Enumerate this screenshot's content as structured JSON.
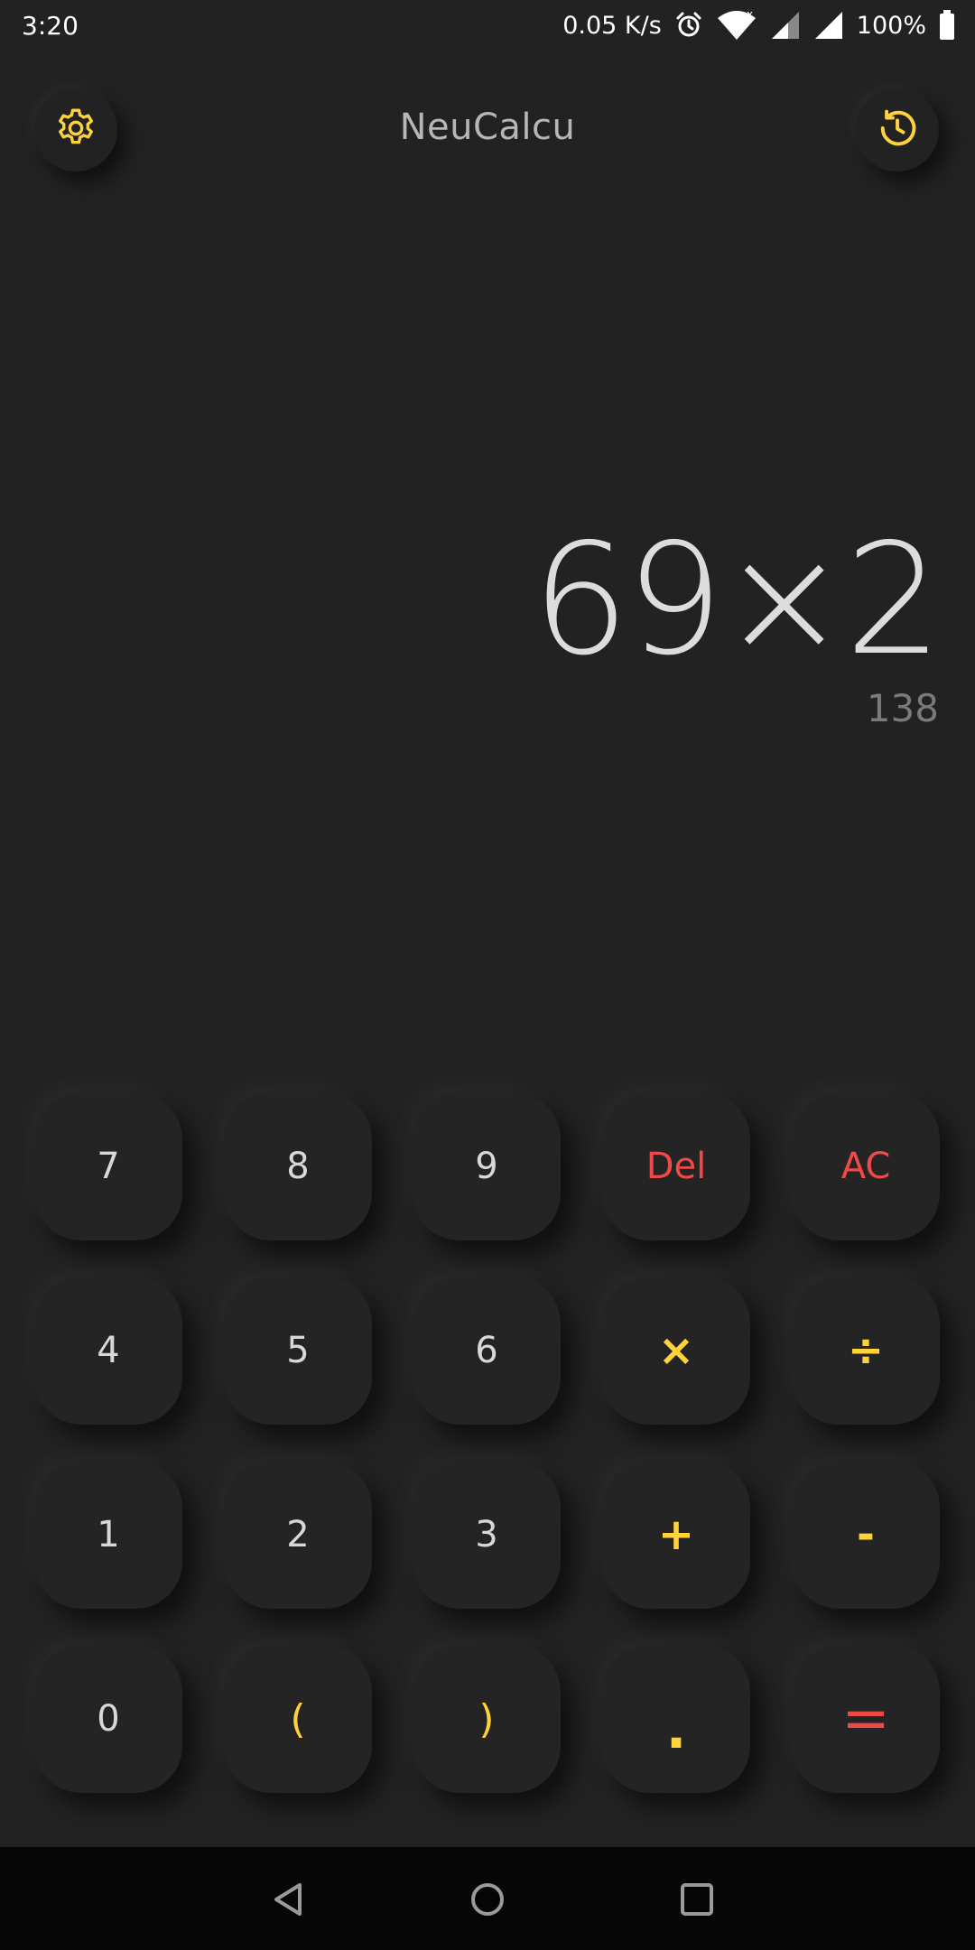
{
  "status_bar": {
    "time": "3:20",
    "network_speed": "0.05 K/s",
    "battery": "100%",
    "icons": [
      "alarm-icon",
      "wifi-icon",
      "signal-icon",
      "signal-icon",
      "battery-icon"
    ]
  },
  "header": {
    "title": "NeuCalcu",
    "settings_icon": "gear-icon",
    "history_icon": "history-icon"
  },
  "display": {
    "expression": "69×2",
    "result": "138"
  },
  "keypad": {
    "rows": [
      [
        {
          "label": "7",
          "type": "digit"
        },
        {
          "label": "8",
          "type": "digit"
        },
        {
          "label": "9",
          "type": "digit"
        },
        {
          "label": "Del",
          "type": "danger"
        },
        {
          "label": "AC",
          "type": "danger"
        }
      ],
      [
        {
          "label": "4",
          "type": "digit"
        },
        {
          "label": "5",
          "type": "digit"
        },
        {
          "label": "6",
          "type": "digit"
        },
        {
          "label": "×",
          "type": "op"
        },
        {
          "label": "÷",
          "type": "op"
        }
      ],
      [
        {
          "label": "1",
          "type": "digit"
        },
        {
          "label": "2",
          "type": "digit"
        },
        {
          "label": "3",
          "type": "digit"
        },
        {
          "label": "+",
          "type": "op"
        },
        {
          "label": "-",
          "type": "op"
        }
      ],
      [
        {
          "label": "0",
          "type": "digit"
        },
        {
          "label": "(",
          "type": "paren"
        },
        {
          "label": ")",
          "type": "paren"
        },
        {
          "label": ".",
          "type": "dot"
        },
        {
          "label": "=",
          "type": "eq"
        }
      ]
    ]
  },
  "nav_bar": {
    "icons": [
      "back-icon",
      "home-icon",
      "recents-icon"
    ]
  },
  "colors": {
    "background": "#222222",
    "accent": "#ffd23c",
    "danger": "#ef4a4a",
    "text": "#d8d8d8",
    "muted": "#7a7a7a"
  }
}
